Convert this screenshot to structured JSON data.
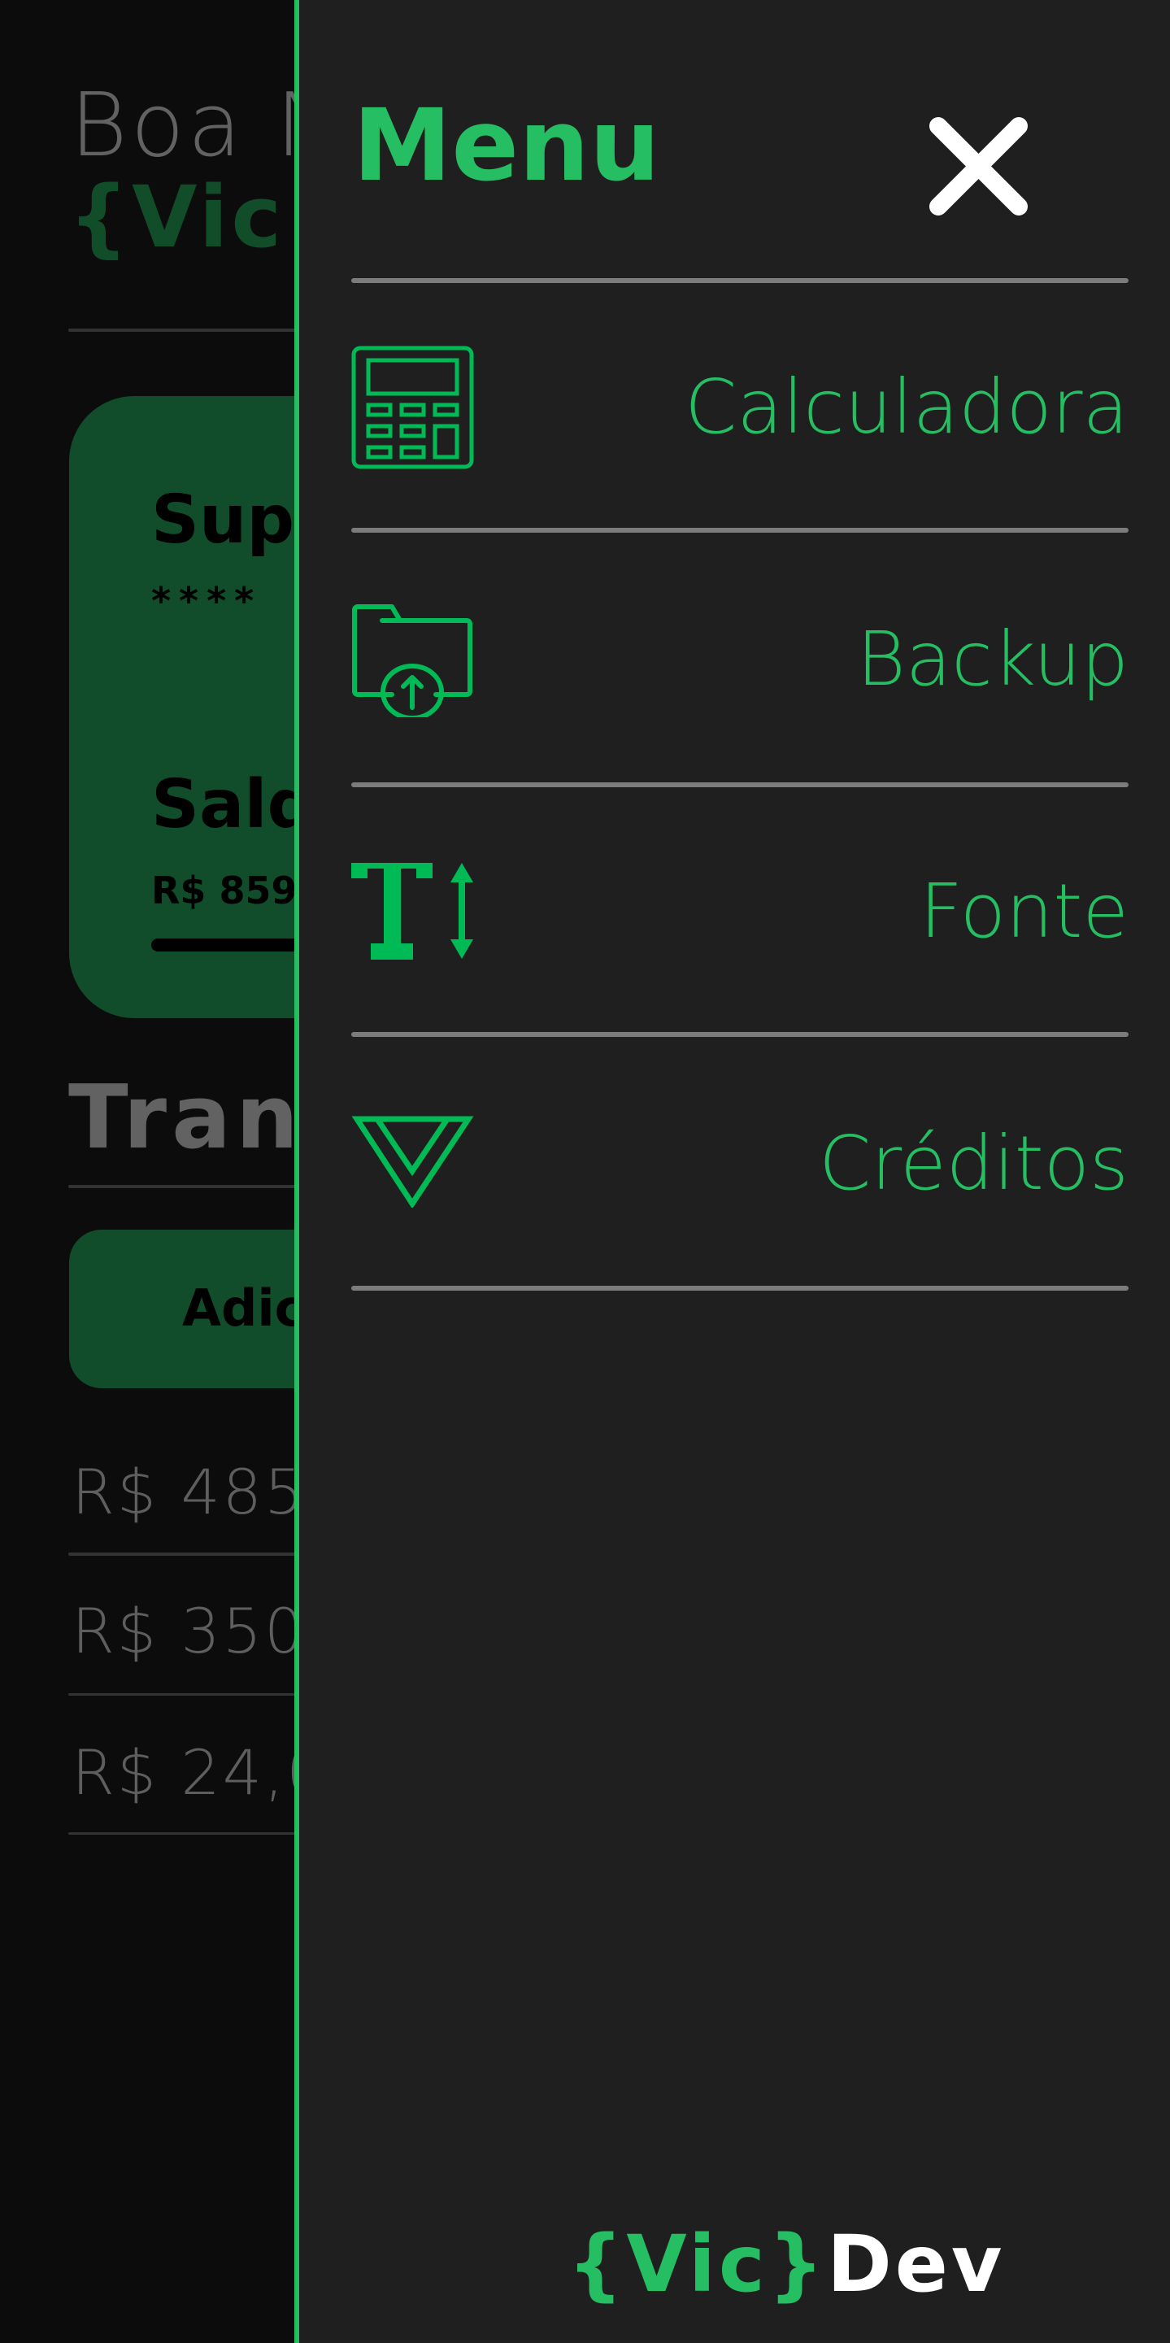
{
  "background": {
    "greeting": "Boa N",
    "user_name": "{Vic}",
    "card": {
      "title": "Sup",
      "masked_number": "****",
      "balance_label": "Sald",
      "balance_value": "R$ 859"
    },
    "section_title": "Trans",
    "add_button": "Adic",
    "transactions": [
      "R$ 485",
      "R$ 350",
      "R$ 24,0"
    ]
  },
  "drawer": {
    "title": "Menu",
    "close_icon": "close-icon",
    "items": [
      {
        "label": "Calculadora",
        "icon": "calculator-icon"
      },
      {
        "label": "Backup",
        "icon": "folder-upload-icon"
      },
      {
        "label": "Fonte",
        "icon": "font-size-icon"
      },
      {
        "label": "Créditos",
        "icon": "credits-triangle-icon"
      }
    ],
    "footer": {
      "brand_green": "{Vic}",
      "brand_white": "Dev"
    }
  },
  "colors": {
    "accent": "#26be62",
    "dim_green": "#114d2a",
    "panel": "#1f1f1f",
    "page": "#0c0c0c"
  }
}
